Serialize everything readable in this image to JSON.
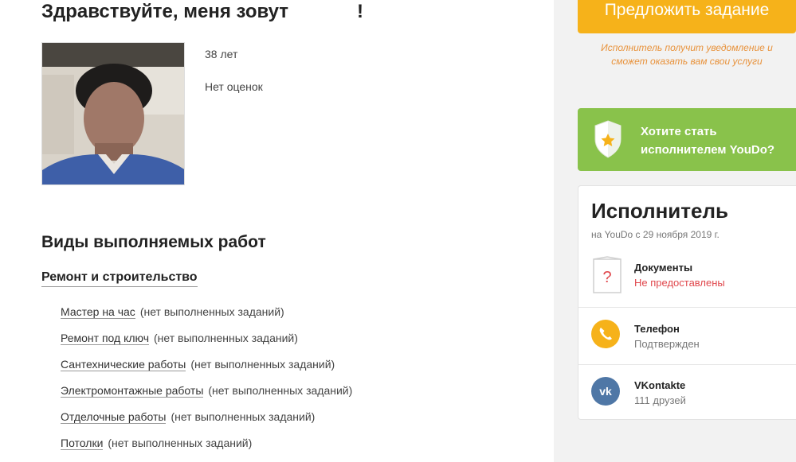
{
  "profile": {
    "greeting_prefix": "Здравствуйте, меня зовут",
    "greeting_suffix": "!",
    "age": "38 лет",
    "rating": "Нет оценок"
  },
  "works": {
    "section_title": "Виды выполняемых работ",
    "category": "Ремонт и строительство",
    "items": [
      {
        "name": "Мастер на час",
        "status": "(нет выполненных заданий)"
      },
      {
        "name": "Ремонт под ключ",
        "status": "(нет выполненных заданий)"
      },
      {
        "name": "Сантехнические работы",
        "status": "(нет выполненных заданий)"
      },
      {
        "name": "Электромонтажные работы",
        "status": "(нет выполненных заданий)"
      },
      {
        "name": "Отделочные работы",
        "status": "(нет выполненных заданий)"
      },
      {
        "name": "Потолки",
        "status": "(нет выполненных заданий)"
      }
    ]
  },
  "sidebar": {
    "offer_button": "Предложить задание",
    "offer_note_line1": "Исполнитель получит уведомление и",
    "offer_note_line2": "сможет оказать вам свои услуги",
    "become_line1": "Хотите стать",
    "become_line2": "исполнителем YouDo?",
    "card_title": "Исполнитель",
    "card_since": "на YouDo с 29 ноября 2019 г.",
    "documents_label": "Документы",
    "documents_value": "Не предоставлены",
    "phone_label": "Телефон",
    "phone_value": "Подтвержден",
    "vk_label": "VKontakte",
    "vk_value": "111 друзей",
    "vk_icon_text": "vk",
    "doc_icon_text": "?"
  },
  "colors": {
    "accent_orange": "#f6b21a",
    "green": "#89c24b",
    "vk_blue": "#4f77a6",
    "red": "#e0474c"
  }
}
